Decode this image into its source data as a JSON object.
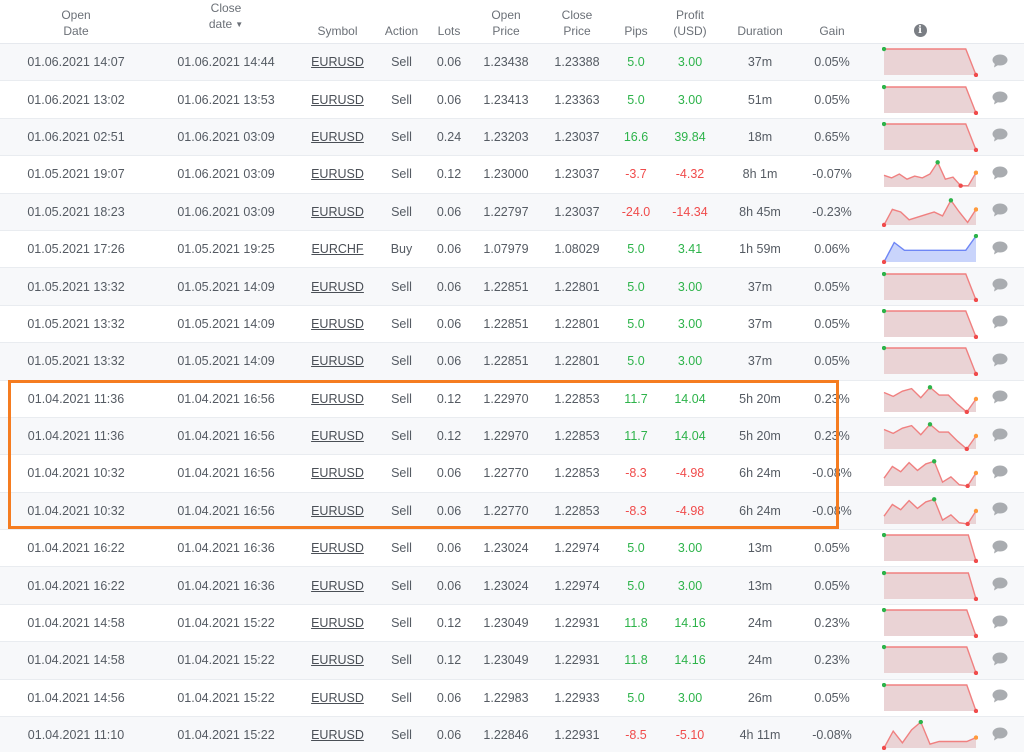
{
  "headers": {
    "open_date": [
      "Open",
      "Date"
    ],
    "close_date": [
      "Close",
      "date"
    ],
    "close_date_sort": "▼",
    "symbol": "Symbol",
    "action": "Action",
    "lots": "Lots",
    "open_price": [
      "Open",
      "Price"
    ],
    "close_price": [
      "Close",
      "Price"
    ],
    "pips": "Pips",
    "profit": [
      "Profit",
      "(USD)"
    ],
    "duration": "Duration",
    "gain": "Gain",
    "info_icon": "i"
  },
  "colors": {
    "positive": "#2db34a",
    "negative": "#f04b4b",
    "highlight": "#f57c20",
    "spark_loss_line": "#f08080",
    "spark_loss_fill": "#ead3d5",
    "spark_gain_line": "#6e86f5",
    "spark_gain_fill": "#c9d4fb"
  },
  "highlight": {
    "rows_from": 10,
    "rows_to": 13
  },
  "rows": [
    {
      "open": "01.06.2021 14:07",
      "close": "01.06.2021 14:44",
      "symbol": "EURUSD",
      "action": "Sell",
      "lots": "0.06",
      "open_price": "1.23438",
      "close_price": "1.23388",
      "pips": "5.0",
      "profit": "3.00",
      "duration": "37m",
      "gain": "0.05%",
      "spark": {
        "type": "loss",
        "values": [
          1,
          1,
          1,
          1,
          1,
          1,
          1,
          1,
          1,
          0
        ],
        "max_i": 0,
        "min_i": 9,
        "end": "min"
      }
    },
    {
      "open": "01.06.2021 13:02",
      "close": "01.06.2021 13:53",
      "symbol": "EURUSD",
      "action": "Sell",
      "lots": "0.06",
      "open_price": "1.23413",
      "close_price": "1.23363",
      "pips": "5.0",
      "profit": "3.00",
      "duration": "51m",
      "gain": "0.05%",
      "spark": {
        "type": "loss",
        "values": [
          1,
          1,
          1,
          1,
          1,
          1,
          1,
          1,
          1,
          0
        ],
        "max_i": 0,
        "min_i": 9,
        "end": "min"
      }
    },
    {
      "open": "01.06.2021 02:51",
      "close": "01.06.2021 03:09",
      "symbol": "EURUSD",
      "action": "Sell",
      "lots": "0.24",
      "open_price": "1.23203",
      "close_price": "1.23037",
      "pips": "16.6",
      "profit": "39.84",
      "duration": "18m",
      "gain": "0.65%",
      "spark": {
        "type": "loss",
        "values": [
          1,
          1,
          1,
          1,
          1,
          1,
          1,
          1,
          1,
          0
        ],
        "max_i": 0,
        "min_i": 9,
        "end": "min"
      }
    },
    {
      "open": "01.05.2021 19:07",
      "close": "01.06.2021 03:09",
      "symbol": "EURUSD",
      "action": "Sell",
      "lots": "0.12",
      "open_price": "1.23000",
      "close_price": "1.23037",
      "pips": "-3.7",
      "profit": "-4.32",
      "duration": "8h 1m",
      "gain": "-0.07%",
      "spark": {
        "type": "loss",
        "values": [
          0.45,
          0.35,
          0.5,
          0.3,
          0.42,
          0.35,
          0.5,
          0.95,
          0.3,
          0.38,
          0.05,
          0.05,
          0.55
        ],
        "max_i": 7,
        "min_i": 10,
        "end": "last"
      }
    },
    {
      "open": "01.05.2021 18:23",
      "close": "01.06.2021 03:09",
      "symbol": "EURUSD",
      "action": "Sell",
      "lots": "0.06",
      "open_price": "1.22797",
      "close_price": "1.23037",
      "pips": "-24.0",
      "profit": "-14.34",
      "duration": "8h 45m",
      "gain": "-0.23%",
      "spark": {
        "type": "loss",
        "values": [
          0,
          0.6,
          0.5,
          0.2,
          0.3,
          0.4,
          0.5,
          0.35,
          0.95,
          0.5,
          0.1,
          0.6
        ],
        "max_i": 8,
        "min_i": 0,
        "end": "last"
      }
    },
    {
      "open": "01.05.2021 17:26",
      "close": "01.05.2021 19:25",
      "symbol": "EURCHF",
      "action": "Buy",
      "lots": "0.06",
      "open_price": "1.07979",
      "close_price": "1.08029",
      "pips": "5.0",
      "profit": "3.41",
      "duration": "1h 59m",
      "gain": "0.06%",
      "spark": {
        "type": "gain",
        "values": [
          0,
          0.75,
          0.45,
          0.45,
          0.45,
          0.45,
          0.45,
          0.45,
          0.45,
          1
        ],
        "max_i": 9,
        "min_i": 0,
        "end": "max"
      }
    },
    {
      "open": "01.05.2021 13:32",
      "close": "01.05.2021 14:09",
      "symbol": "EURUSD",
      "action": "Sell",
      "lots": "0.06",
      "open_price": "1.22851",
      "close_price": "1.22801",
      "pips": "5.0",
      "profit": "3.00",
      "duration": "37m",
      "gain": "0.05%",
      "spark": {
        "type": "loss",
        "values": [
          1,
          1,
          1,
          1,
          1,
          1,
          1,
          1,
          1,
          0
        ],
        "max_i": 0,
        "min_i": 9,
        "end": "min"
      }
    },
    {
      "open": "01.05.2021 13:32",
      "close": "01.05.2021 14:09",
      "symbol": "EURUSD",
      "action": "Sell",
      "lots": "0.06",
      "open_price": "1.22851",
      "close_price": "1.22801",
      "pips": "5.0",
      "profit": "3.00",
      "duration": "37m",
      "gain": "0.05%",
      "spark": {
        "type": "loss",
        "values": [
          1,
          1,
          1,
          1,
          1,
          1,
          1,
          1,
          1,
          0
        ],
        "max_i": 0,
        "min_i": 9,
        "end": "min"
      }
    },
    {
      "open": "01.05.2021 13:32",
      "close": "01.05.2021 14:09",
      "symbol": "EURUSD",
      "action": "Sell",
      "lots": "0.06",
      "open_price": "1.22851",
      "close_price": "1.22801",
      "pips": "5.0",
      "profit": "3.00",
      "duration": "37m",
      "gain": "0.05%",
      "spark": {
        "type": "loss",
        "values": [
          1,
          1,
          1,
          1,
          1,
          1,
          1,
          1,
          1,
          0
        ],
        "max_i": 0,
        "min_i": 9,
        "end": "min"
      }
    },
    {
      "open": "01.04.2021 11:36",
      "close": "01.04.2021 16:56",
      "symbol": "EURUSD",
      "action": "Sell",
      "lots": "0.12",
      "open_price": "1.22970",
      "close_price": "1.22853",
      "pips": "11.7",
      "profit": "14.04",
      "duration": "5h 20m",
      "gain": "0.23%",
      "spark": {
        "type": "loss",
        "values": [
          0.75,
          0.6,
          0.8,
          0.9,
          0.55,
          0.95,
          0.65,
          0.65,
          0.3,
          0,
          0.5
        ],
        "max_i": 5,
        "min_i": 9,
        "end": "last"
      }
    },
    {
      "open": "01.04.2021 11:36",
      "close": "01.04.2021 16:56",
      "symbol": "EURUSD",
      "action": "Sell",
      "lots": "0.12",
      "open_price": "1.22970",
      "close_price": "1.22853",
      "pips": "11.7",
      "profit": "14.04",
      "duration": "5h 20m",
      "gain": "0.23%",
      "spark": {
        "type": "loss",
        "values": [
          0.75,
          0.6,
          0.8,
          0.9,
          0.55,
          0.95,
          0.65,
          0.65,
          0.3,
          0,
          0.5
        ],
        "max_i": 5,
        "min_i": 9,
        "end": "last"
      }
    },
    {
      "open": "01.04.2021 10:32",
      "close": "01.04.2021 16:56",
      "symbol": "EURUSD",
      "action": "Sell",
      "lots": "0.06",
      "open_price": "1.22770",
      "close_price": "1.22853",
      "pips": "-8.3",
      "profit": "-4.98",
      "duration": "6h 24m",
      "gain": "-0.08%",
      "spark": {
        "type": "loss",
        "values": [
          0.3,
          0.75,
          0.55,
          0.9,
          0.6,
          0.85,
          0.95,
          0.15,
          0.35,
          0.05,
          0,
          0.5
        ],
        "max_i": 6,
        "min_i": 10,
        "end": "last"
      }
    },
    {
      "open": "01.04.2021 10:32",
      "close": "01.04.2021 16:56",
      "symbol": "EURUSD",
      "action": "Sell",
      "lots": "0.06",
      "open_price": "1.22770",
      "close_price": "1.22853",
      "pips": "-8.3",
      "profit": "-4.98",
      "duration": "6h 24m",
      "gain": "-0.08%",
      "spark": {
        "type": "loss",
        "values": [
          0.3,
          0.75,
          0.55,
          0.9,
          0.6,
          0.85,
          0.95,
          0.15,
          0.35,
          0.05,
          0,
          0.5
        ],
        "max_i": 6,
        "min_i": 10,
        "end": "last"
      }
    },
    {
      "open": "01.04.2021 16:22",
      "close": "01.04.2021 16:36",
      "symbol": "EURUSD",
      "action": "Sell",
      "lots": "0.06",
      "open_price": "1.23024",
      "close_price": "1.22974",
      "pips": "5.0",
      "profit": "3.00",
      "duration": "13m",
      "gain": "0.05%",
      "spark": {
        "type": "loss",
        "values": [
          1,
          1,
          1,
          1,
          1,
          1,
          1,
          1,
          1,
          1,
          1,
          1,
          0
        ],
        "max_i": 0,
        "min_i": 12,
        "end": "min"
      }
    },
    {
      "open": "01.04.2021 16:22",
      "close": "01.04.2021 16:36",
      "symbol": "EURUSD",
      "action": "Sell",
      "lots": "0.06",
      "open_price": "1.23024",
      "close_price": "1.22974",
      "pips": "5.0",
      "profit": "3.00",
      "duration": "13m",
      "gain": "0.05%",
      "spark": {
        "type": "loss",
        "values": [
          1,
          1,
          1,
          1,
          1,
          1,
          1,
          1,
          1,
          1,
          1,
          1,
          0
        ],
        "max_i": 0,
        "min_i": 12,
        "end": "min"
      }
    },
    {
      "open": "01.04.2021 14:58",
      "close": "01.04.2021 15:22",
      "symbol": "EURUSD",
      "action": "Sell",
      "lots": "0.12",
      "open_price": "1.23049",
      "close_price": "1.22931",
      "pips": "11.8",
      "profit": "14.16",
      "duration": "24m",
      "gain": "0.23%",
      "spark": {
        "type": "loss",
        "values": [
          1,
          1,
          1,
          1,
          1,
          1,
          1,
          1,
          1,
          1,
          0
        ],
        "max_i": 0,
        "min_i": 10,
        "end": "min"
      }
    },
    {
      "open": "01.04.2021 14:58",
      "close": "01.04.2021 15:22",
      "symbol": "EURUSD",
      "action": "Sell",
      "lots": "0.12",
      "open_price": "1.23049",
      "close_price": "1.22931",
      "pips": "11.8",
      "profit": "14.16",
      "duration": "24m",
      "gain": "0.23%",
      "spark": {
        "type": "loss",
        "values": [
          1,
          1,
          1,
          1,
          1,
          1,
          1,
          1,
          1,
          1,
          0
        ],
        "max_i": 0,
        "min_i": 10,
        "end": "min"
      }
    },
    {
      "open": "01.04.2021 14:56",
      "close": "01.04.2021 15:22",
      "symbol": "EURUSD",
      "action": "Sell",
      "lots": "0.06",
      "open_price": "1.22983",
      "close_price": "1.22933",
      "pips": "5.0",
      "profit": "3.00",
      "duration": "26m",
      "gain": "0.05%",
      "spark": {
        "type": "loss",
        "values": [
          1,
          1,
          1,
          1,
          1,
          1,
          1,
          1,
          1,
          1,
          0
        ],
        "max_i": 0,
        "min_i": 10,
        "end": "min"
      }
    },
    {
      "open": "01.04.2021 11:10",
      "close": "01.04.2021 15:22",
      "symbol": "EURUSD",
      "action": "Sell",
      "lots": "0.06",
      "open_price": "1.22846",
      "close_price": "1.22931",
      "pips": "-8.5",
      "profit": "-5.10",
      "duration": "4h 11m",
      "gain": "-0.08%",
      "spark": {
        "type": "loss",
        "values": [
          0,
          0.65,
          0.2,
          0.7,
          1,
          0.15,
          0.25,
          0.25,
          0.25,
          0.25,
          0.4
        ],
        "max_i": 4,
        "min_i": 0,
        "end": "last"
      }
    }
  ]
}
